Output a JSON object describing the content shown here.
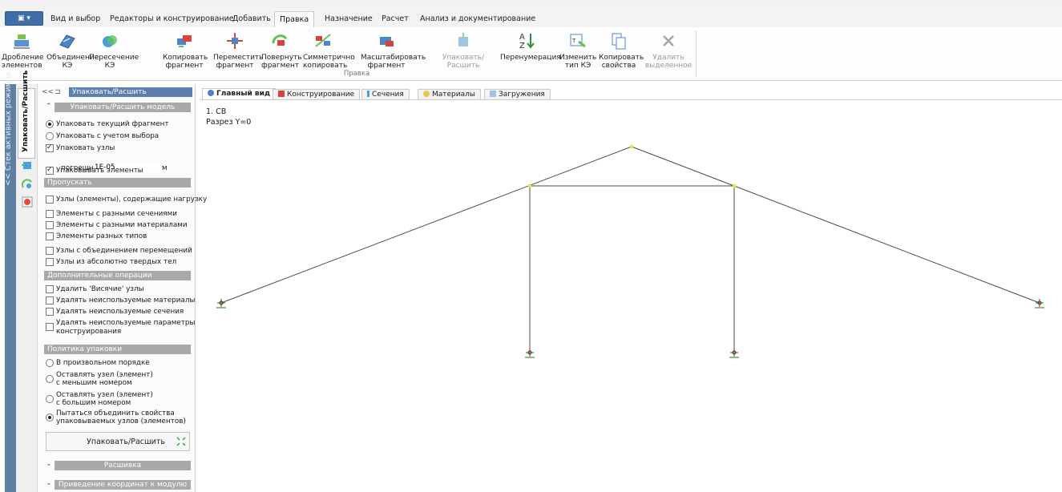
{
  "menu": {
    "app_button": "▣ ▾",
    "tabs": [
      "Вид и выбор",
      "Редакторы и конструирование",
      "Добавить",
      "Правка",
      "Назначение",
      "Расчет",
      "Анализ и документирование"
    ],
    "active_tab": "Правка"
  },
  "ribbon": {
    "group_label": "Правка",
    "buttons": [
      {
        "l1": "Дробление",
        "l2": "элементов",
        "disabled": false
      },
      {
        "l1": "Объединение",
        "l2": "КЭ",
        "disabled": false
      },
      {
        "l1": "Пересечение",
        "l2": "КЭ",
        "disabled": false
      },
      {
        "l1": "Копировать",
        "l2": "фрагмент",
        "disabled": false
      },
      {
        "l1": "Переместить",
        "l2": "фрагмент",
        "disabled": false
      },
      {
        "l1": "Повернуть",
        "l2": "фрагмент",
        "disabled": false
      },
      {
        "l1": "Симметрично",
        "l2": "копировать",
        "disabled": false
      },
      {
        "l1": "Масштабировать",
        "l2": "фрагмент",
        "disabled": false
      },
      {
        "l1": "Упаковать/Расшить",
        "l2": "",
        "disabled": true
      },
      {
        "l1": "Перенумерация",
        "l2": "",
        "disabled": false
      },
      {
        "l1": "Изменить",
        "l2": "тип КЭ",
        "disabled": false
      },
      {
        "l1": "Копировать",
        "l2": "свойства",
        "disabled": false
      },
      {
        "l1": "Удалить",
        "l2": "выделенное",
        "disabled": true
      }
    ]
  },
  "left_strip": {
    "stack_label": "<< Стек активных режимов",
    "mode_tab": "Упаковать/Расшить"
  },
  "panel": {
    "collapse_btn": "<<",
    "pin": "⊐",
    "title": "Упаковать/Расшить",
    "section_pack": "Упаковать/Расшить модель",
    "pack_current": "Упаковать текущий фрагмент",
    "pack_selection": "Упаковать с учетом выбора",
    "pack_nodes": "Упаковать узлы",
    "tolerance_label": "погрешность",
    "tolerance_value": "1E-05",
    "tolerance_unit": "м",
    "pack_elements": "Упаковывать элементы",
    "skip_header": "Пропускать",
    "skip_items": [
      "Узлы (элементы), содержащие нагрузку",
      "Элементы с разными сечениями",
      "Элементы с разными материалами",
      "Элементы разных типов",
      "Узлы с объединением перемещений",
      "Узлы из абсолютно твердых тел"
    ],
    "extra_header": "Дополнительные операции",
    "extra_items": [
      "Удалить 'Висячие' узлы",
      "Удалять неиспользуемые материалы",
      "Удалять неиспользуемые сечения",
      "Удалять неиспользуемые параметры",
      "конструирования"
    ],
    "policy_header": "Политика упаковки",
    "policy_items": [
      {
        "l1": "В произвольном порядке",
        "l2": ""
      },
      {
        "l1": "Оставлять узел (элемент)",
        "l2": "с меньшим номером"
      },
      {
        "l1": "Оставлять узел (элемент)",
        "l2": "с большим номером"
      },
      {
        "l1": "Пытаться объединить свойства",
        "l2": "упаковываемых узлов (элементов)"
      }
    ],
    "pack_button": "Упаковать/Расшить",
    "section_unstitch": "Расшивка",
    "section_modulo": "Приведение координат к модулю"
  },
  "view": {
    "tabs": [
      "Главный вид",
      "Конструирование",
      "Сечения",
      "Материалы",
      "Загружения"
    ],
    "active_tab": "Главный вид",
    "info_line1": "1. СВ",
    "info_line2": "Разрез Y=0"
  },
  "colors": {
    "panel_title_bg": "#5b7fae",
    "section_bg": "#a9a9a9",
    "frame_line": "#4a4a4a",
    "node_highlight": "#e5e533",
    "support_red": "#d03a2a",
    "support_green": "#2e9a3c"
  }
}
